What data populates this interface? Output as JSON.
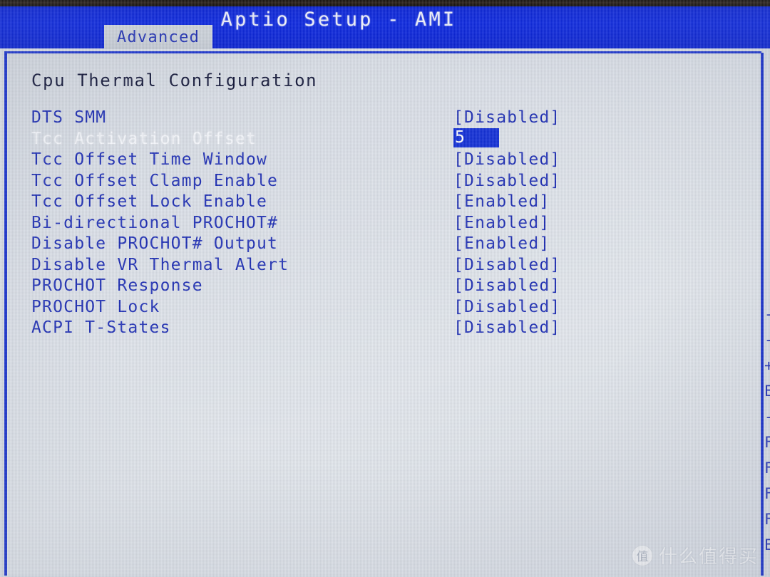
{
  "window": {
    "title": "Aptio Setup - AMI"
  },
  "tabs": [
    {
      "label": "Advanced",
      "active": true
    }
  ],
  "main": {
    "page_heading": "Cpu Thermal Configuration",
    "rows": [
      {
        "label": "DTS SMM",
        "value": "[Disabled]",
        "selected": false,
        "editing": false
      },
      {
        "label": "Tcc Activation Offset",
        "value": "5",
        "selected": true,
        "editing": true
      },
      {
        "label": "Tcc Offset Time Window",
        "value": "[Disabled]",
        "selected": false,
        "editing": false
      },
      {
        "label": "Tcc Offset Clamp Enable",
        "value": "[Disabled]",
        "selected": false,
        "editing": false
      },
      {
        "label": "Tcc Offset Lock Enable",
        "value": "[Enabled]",
        "selected": false,
        "editing": false
      },
      {
        "label": "Bi-directional PROCHOT#",
        "value": "[Enabled]",
        "selected": false,
        "editing": false
      },
      {
        "label": "Disable PROCHOT# Output",
        "value": "[Enabled]",
        "selected": false,
        "editing": false
      },
      {
        "label": "Disable VR Thermal Alert",
        "value": "[Disabled]",
        "selected": false,
        "editing": false
      },
      {
        "label": "PROCHOT Response",
        "value": "[Disabled]",
        "selected": false,
        "editing": false
      },
      {
        "label": "PROCHOT Lock",
        "value": "[Disabled]",
        "selected": false,
        "editing": false
      },
      {
        "label": "ACPI T-States",
        "value": "[Disabled]",
        "selected": false,
        "editing": false
      }
    ]
  },
  "help_panel": {
    "cut_off": true,
    "lines": [
      "-",
      "-",
      "+",
      "E",
      "-",
      "F",
      "F",
      "F",
      "F",
      "E"
    ]
  },
  "watermark": {
    "badge": "值",
    "text": "什么值得买"
  },
  "colors": {
    "header_blue": "#0b27e2",
    "frame_blue": "#1b34cf",
    "text_blue": "#1f2fb4",
    "selected_text": "#f4f6fb",
    "edit_box_bg": "#1430d6",
    "screen_bg": "#dbe0e8",
    "heading_text": "#14183a",
    "title_text": "#f2f4ff"
  }
}
